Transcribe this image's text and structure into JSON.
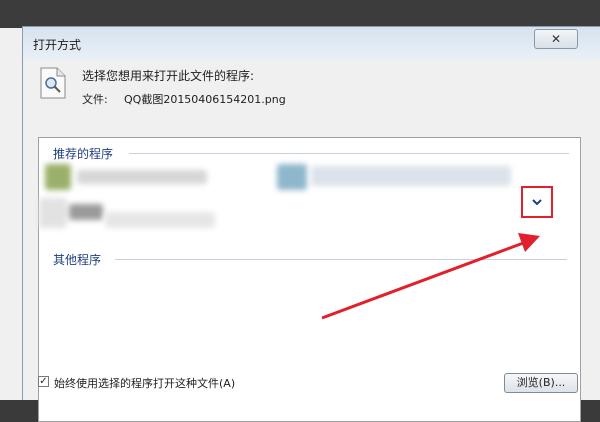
{
  "dialog": {
    "title": "打开方式",
    "close_label": "✕",
    "prompt": "选择您想用来打开此文件的程序:",
    "file_label": "文件:",
    "file_name": "QQ截图20150406154201.png"
  },
  "groups": {
    "recommended": "推荐的程序",
    "other": "其他程序"
  },
  "expand_icon": "chevron-down-icon",
  "footer": {
    "always_use_label": "始终使用选择的程序打开这种文件(A)",
    "always_use_checked": true,
    "browse_label": "浏览(B)..."
  },
  "colors": {
    "group_header": "#1e3f80",
    "highlight_box": "#e0202c",
    "arrow": "#e0202c"
  }
}
